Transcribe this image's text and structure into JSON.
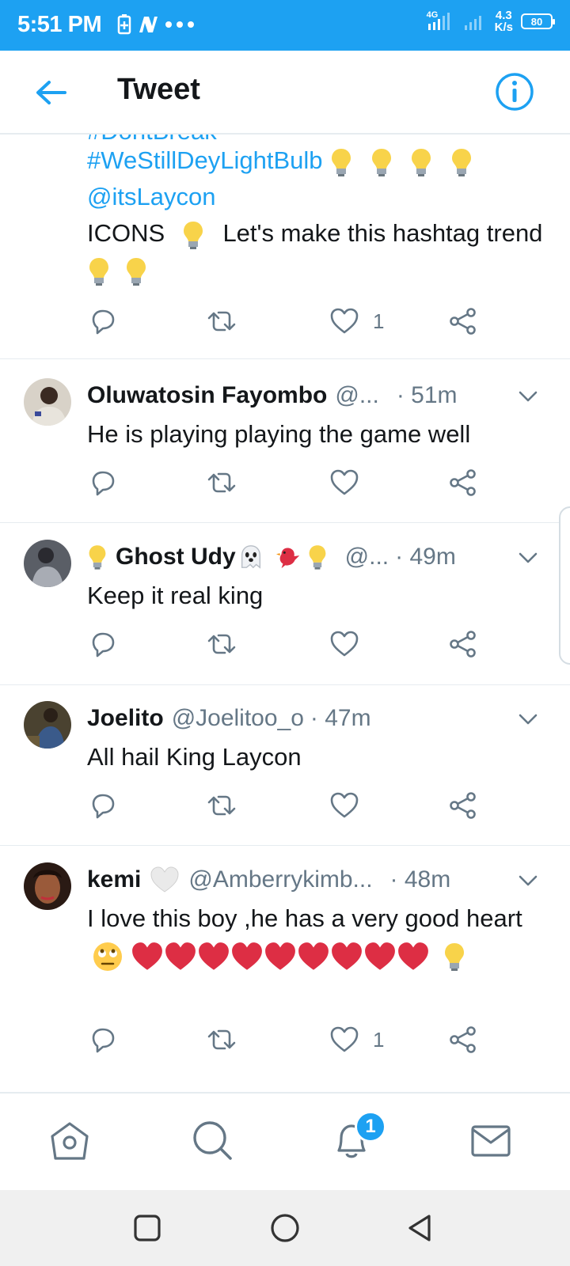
{
  "status_bar": {
    "time": "5:51 PM",
    "network": "4G",
    "speed_value": "4.3",
    "speed_unit": "K/s",
    "battery": "80",
    "icons": [
      "battery-saver-icon",
      "n-app-icon",
      "more-dots-icon",
      "signal-icon",
      "signal-icon-2"
    ]
  },
  "header": {
    "title": "Tweet",
    "back_icon": "arrow-left-icon",
    "info_icon": "info-icon"
  },
  "original_tweet": {
    "cut_line": "#DontBreak",
    "hashtag": "#WeStillDeyLightBulb",
    "mention": "@itsLaycon",
    "text_a": "ICONS",
    "text_b": "Let's make this hashtag trend",
    "likes": "1"
  },
  "replies": [
    {
      "name": "Oluwatosin Fayombo",
      "handle": "@...",
      "time": "· 51m",
      "text": "He is playing playing the game well",
      "likes": ""
    },
    {
      "name": "Ghost Udy",
      "handle": "@...",
      "time": "· 49m",
      "text": "Keep it real king",
      "likes": ""
    },
    {
      "name": "Joelito",
      "handle": "@Joelitoo_o",
      "time": "· 47m",
      "text": "All hail King Laycon",
      "likes": ""
    },
    {
      "name": "kemi",
      "handle": "@Amberrykimb...",
      "time": "· 48m",
      "text": "I love this boy ,he has a very good heart",
      "likes": "1"
    }
  ],
  "bottom_nav": {
    "items": [
      "home-icon",
      "search-icon",
      "notifications-icon",
      "messages-icon"
    ],
    "notification_badge": "1"
  },
  "colors": {
    "accent": "#1da1f2",
    "text": "#14171a",
    "muted": "#657786",
    "heart": "#e0245e"
  }
}
